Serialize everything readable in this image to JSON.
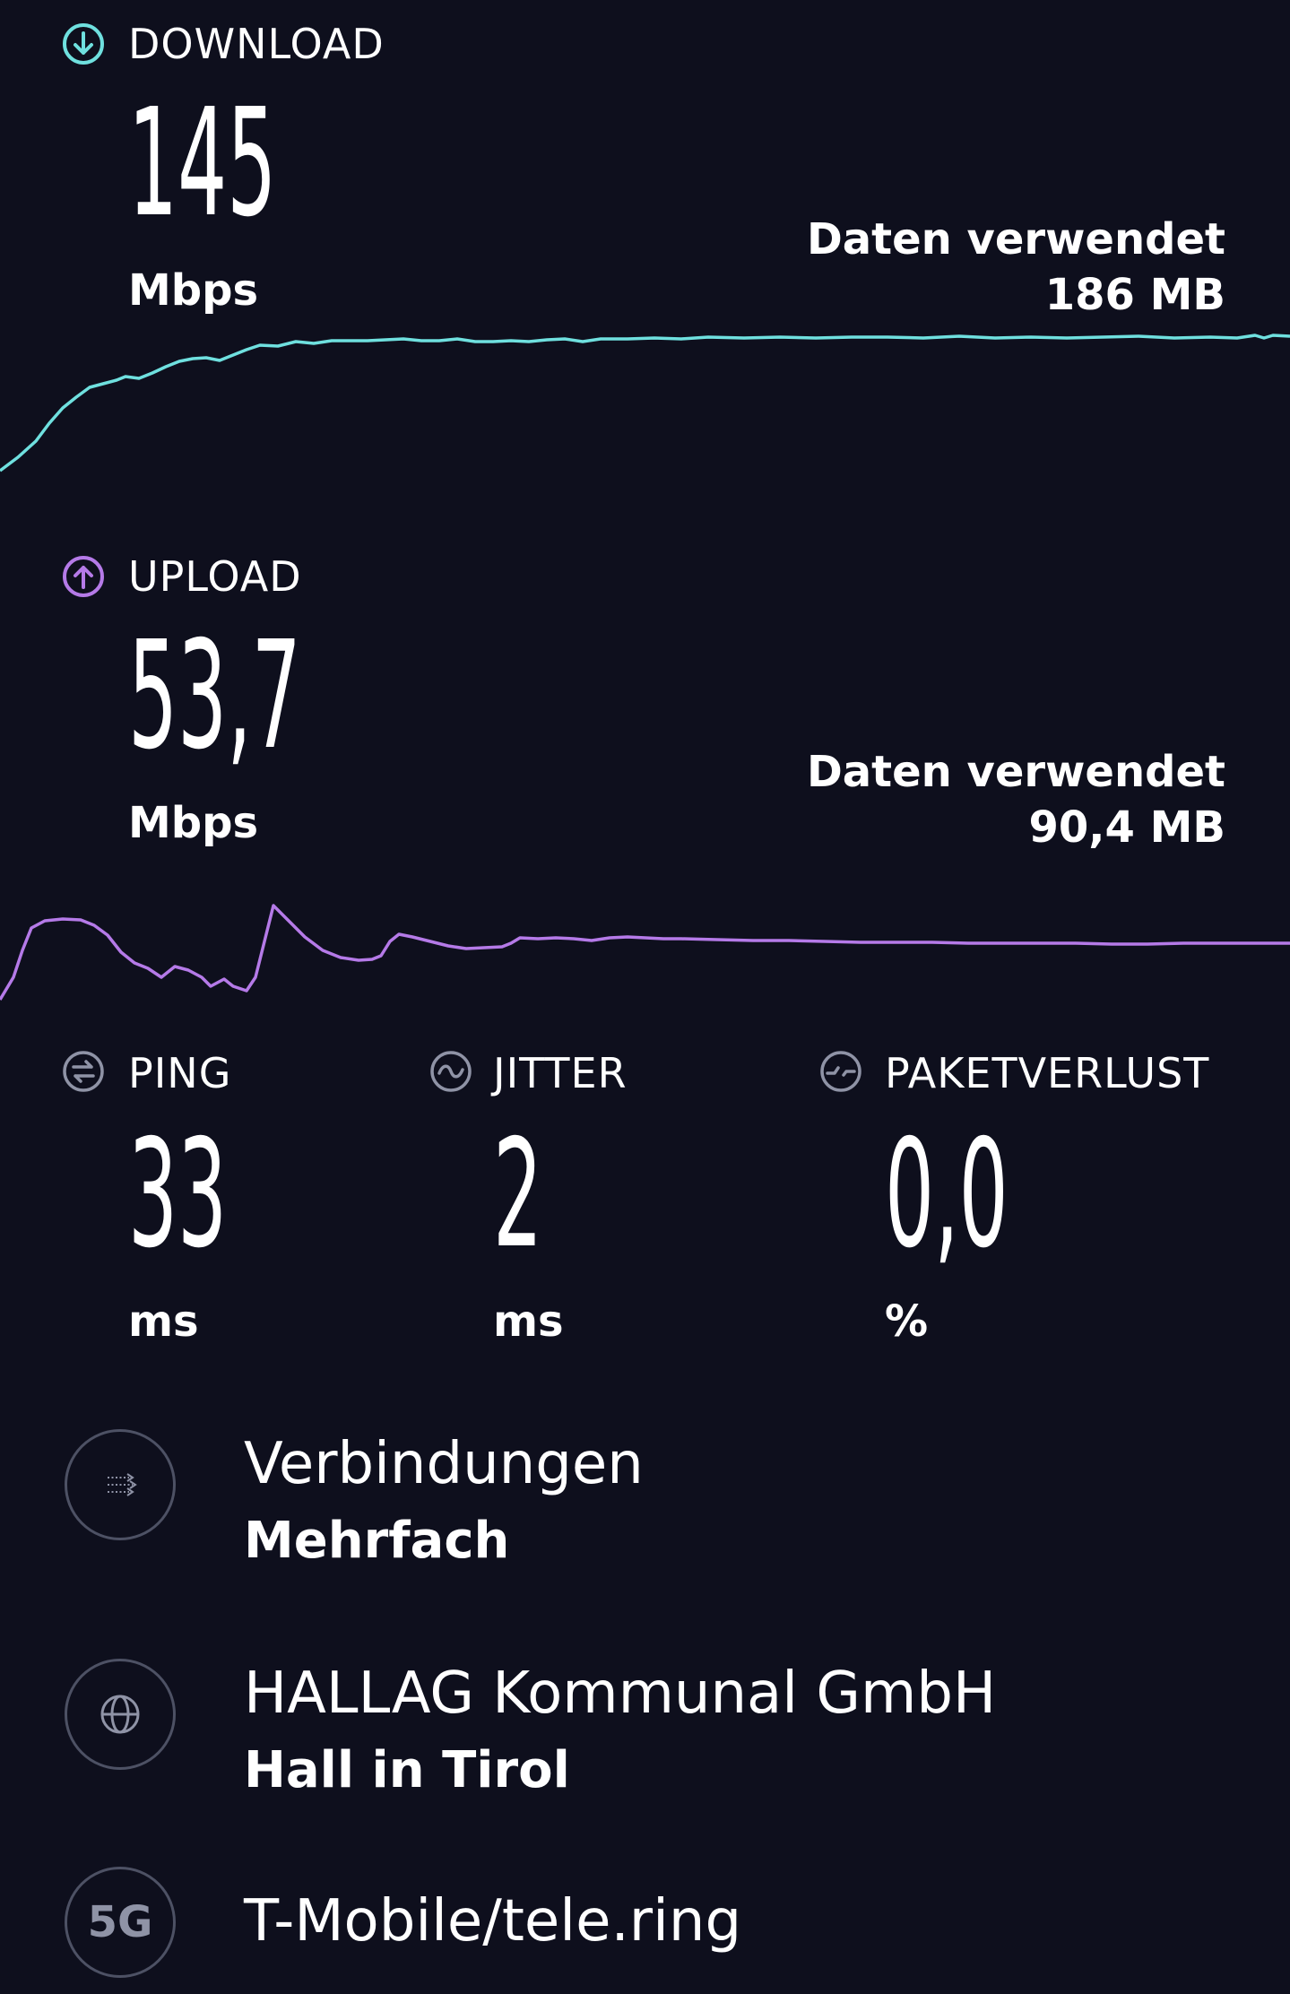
{
  "download": {
    "label": "DOWNLOAD",
    "value": "145",
    "unit": "Mbps",
    "data_used_label": "Daten verwendet",
    "data_used_value": "186 MB",
    "color": "#6fe0df"
  },
  "upload": {
    "label": "UPLOAD",
    "value": "53,7",
    "unit": "Mbps",
    "data_used_label": "Daten verwendet",
    "data_used_value": "90,4 MB",
    "color": "#b57ae8"
  },
  "ping": {
    "label": "PING",
    "value": "33",
    "unit": "ms"
  },
  "jitter": {
    "label": "JITTER",
    "value": "2",
    "unit": "ms"
  },
  "packet_loss": {
    "label": "PAKETVERLUST",
    "value": "0,0",
    "unit": "%"
  },
  "info_rows": [
    {
      "icon": "connections-icon",
      "title": "Verbindungen",
      "subtitle": "Mehrfach"
    },
    {
      "icon": "globe-icon",
      "title": "HALLAG Kommunal GmbH",
      "subtitle": "Hall in Tirol"
    },
    {
      "icon": "5g-icon",
      "icon_text": "5G",
      "title": "T-Mobile/tele.ring",
      "subtitle": ""
    }
  ],
  "colors": {
    "background": "#0e0f1d",
    "icon_gray": "#8f93a6"
  }
}
